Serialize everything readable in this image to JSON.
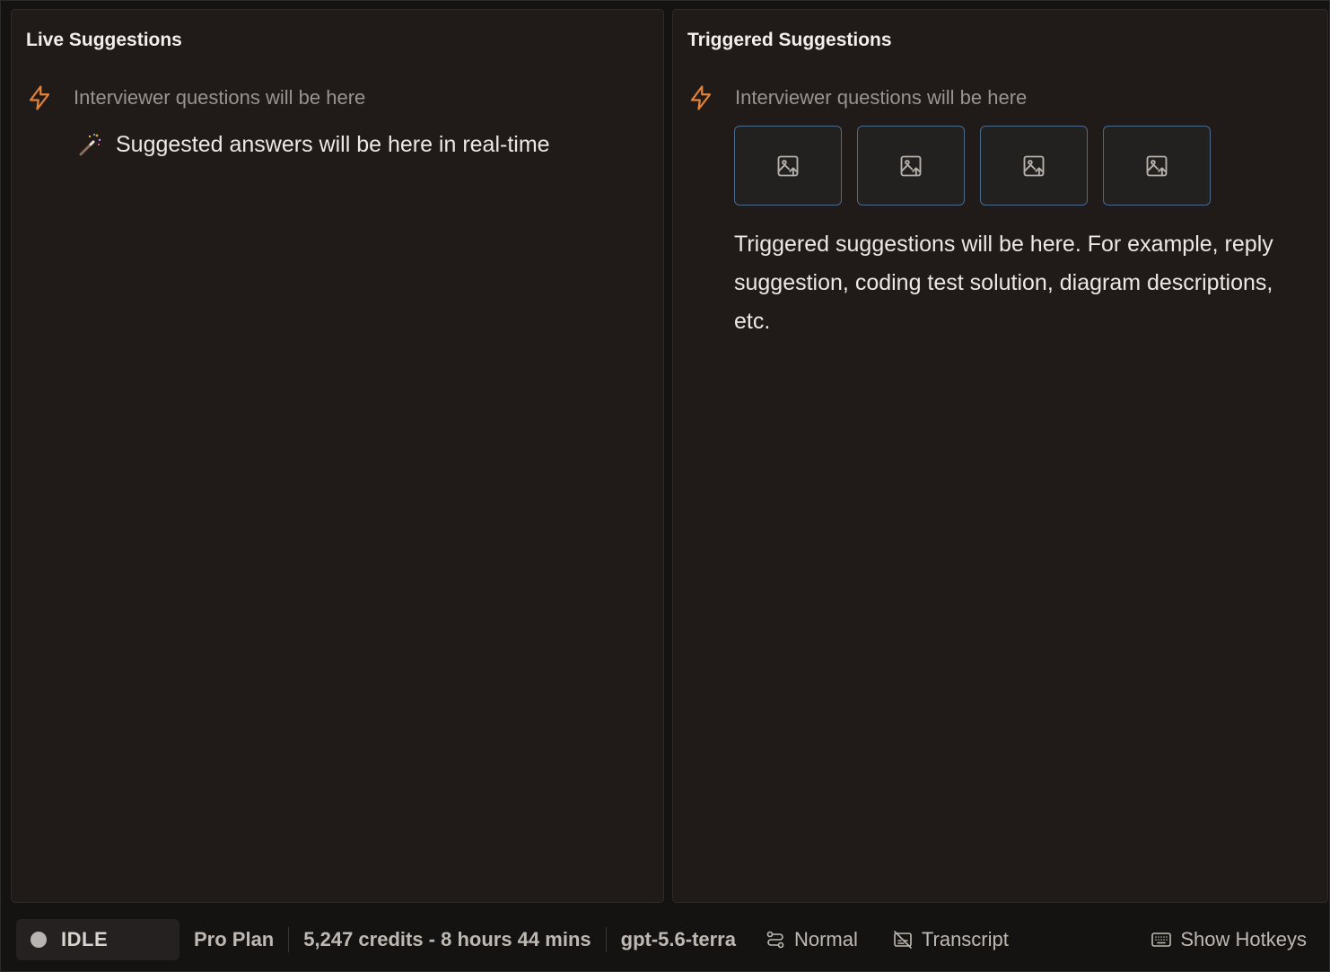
{
  "left_panel": {
    "title": "Live Suggestions",
    "question_placeholder": "Interviewer questions will be here",
    "answer_placeholder": "Suggested answers will be here in real-time"
  },
  "right_panel": {
    "title": "Triggered Suggestions",
    "question_placeholder": "Interviewer questions will be here",
    "image_slots": [
      "image-upload-icon",
      "image-upload-icon",
      "image-upload-icon",
      "image-upload-icon"
    ],
    "suggestion_placeholder": "Triggered suggestions will be here. For example, reply suggestion, coding test solution, diagram descriptions, etc."
  },
  "status_bar": {
    "status": "IDLE",
    "plan": "Pro Plan",
    "credits": "5,247 credits - 8 hours 44 mins",
    "model": "gpt-5.6-terra",
    "mode": "Normal",
    "transcript": "Transcript",
    "hotkeys": "Show Hotkeys"
  },
  "colors": {
    "panel_bg": "#201a19",
    "accent_bolt": "#e0823a",
    "thumb_border": "#4a6a8e"
  }
}
